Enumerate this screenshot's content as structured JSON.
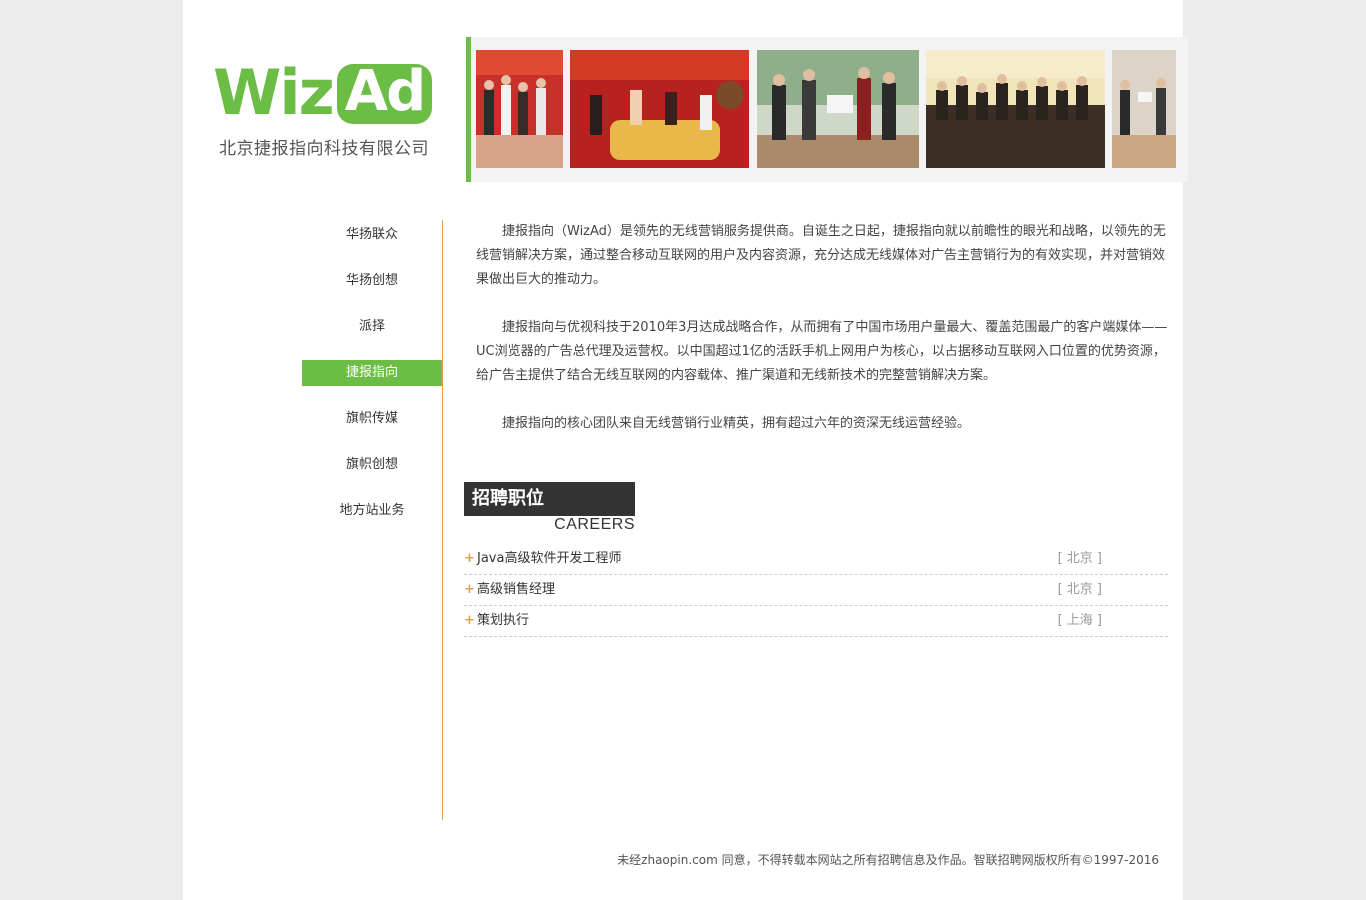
{
  "header": {
    "logo_wiz": "Wiz",
    "logo_ad": "Ad",
    "company_name": "北京捷报指向科技有限公司"
  },
  "banner": {
    "photos": [
      "team-photo-1",
      "team-photo-2",
      "team-photo-3",
      "team-photo-4",
      "team-photo-5"
    ]
  },
  "nav": {
    "items": [
      {
        "label": "华扬联众",
        "active": false
      },
      {
        "label": "华扬创想",
        "active": false
      },
      {
        "label": "派择",
        "active": false
      },
      {
        "label": "捷报指向",
        "active": true
      },
      {
        "label": "旗帜传媒",
        "active": false
      },
      {
        "label": "旗帜创想",
        "active": false
      },
      {
        "label": "地方站业务",
        "active": false
      }
    ]
  },
  "intro": {
    "p1": "捷报指向（WizAd）是领先的无线营销服务提供商。自诞生之日起，捷报指向就以前瞻性的眼光和战略，以领先的无线营销解决方案，通过整合移动互联网的用户及内容资源，充分达成无线媒体对广告主营销行为的有效实现，并对营销效果做出巨大的推动力。",
    "p2": "捷报指向与优视科技于2010年3月达成战略合作，从而拥有了中国市场用户量最大、覆盖范围最广的客户端媒体——UC浏览器的广告总代理及运营权。以中国超过1亿的活跃手机上网用户为核心，以占据移动互联网入口位置的优势资源，给广告主提供了结合无线互联网的内容载体、推广渠道和无线新技术的完整营销解决方案。",
    "p3": "捷报指向的核心团队来自无线营销行业精英，拥有超过六年的资深无线运营经验。"
  },
  "careers": {
    "title_zh": "招聘职位",
    "title_en": "CAREERS",
    "jobs": [
      {
        "plus": "+",
        "title": "Java高级软件开发工程师",
        "location": "[ 北京 ]"
      },
      {
        "plus": "+",
        "title": "高级销售经理",
        "location": "[ 北京 ]"
      },
      {
        "plus": "+",
        "title": "策划执行",
        "location": "[ 上海 ]"
      }
    ]
  },
  "footer": {
    "text": "未经zhaopin.com 同意，不得转载本网站之所有招聘信息及作品。智联招聘网版权所有©1997-2016"
  },
  "colors": {
    "brand_green": "#6cbd45",
    "divider_orange": "#e0a050",
    "careers_dark": "#333333"
  }
}
